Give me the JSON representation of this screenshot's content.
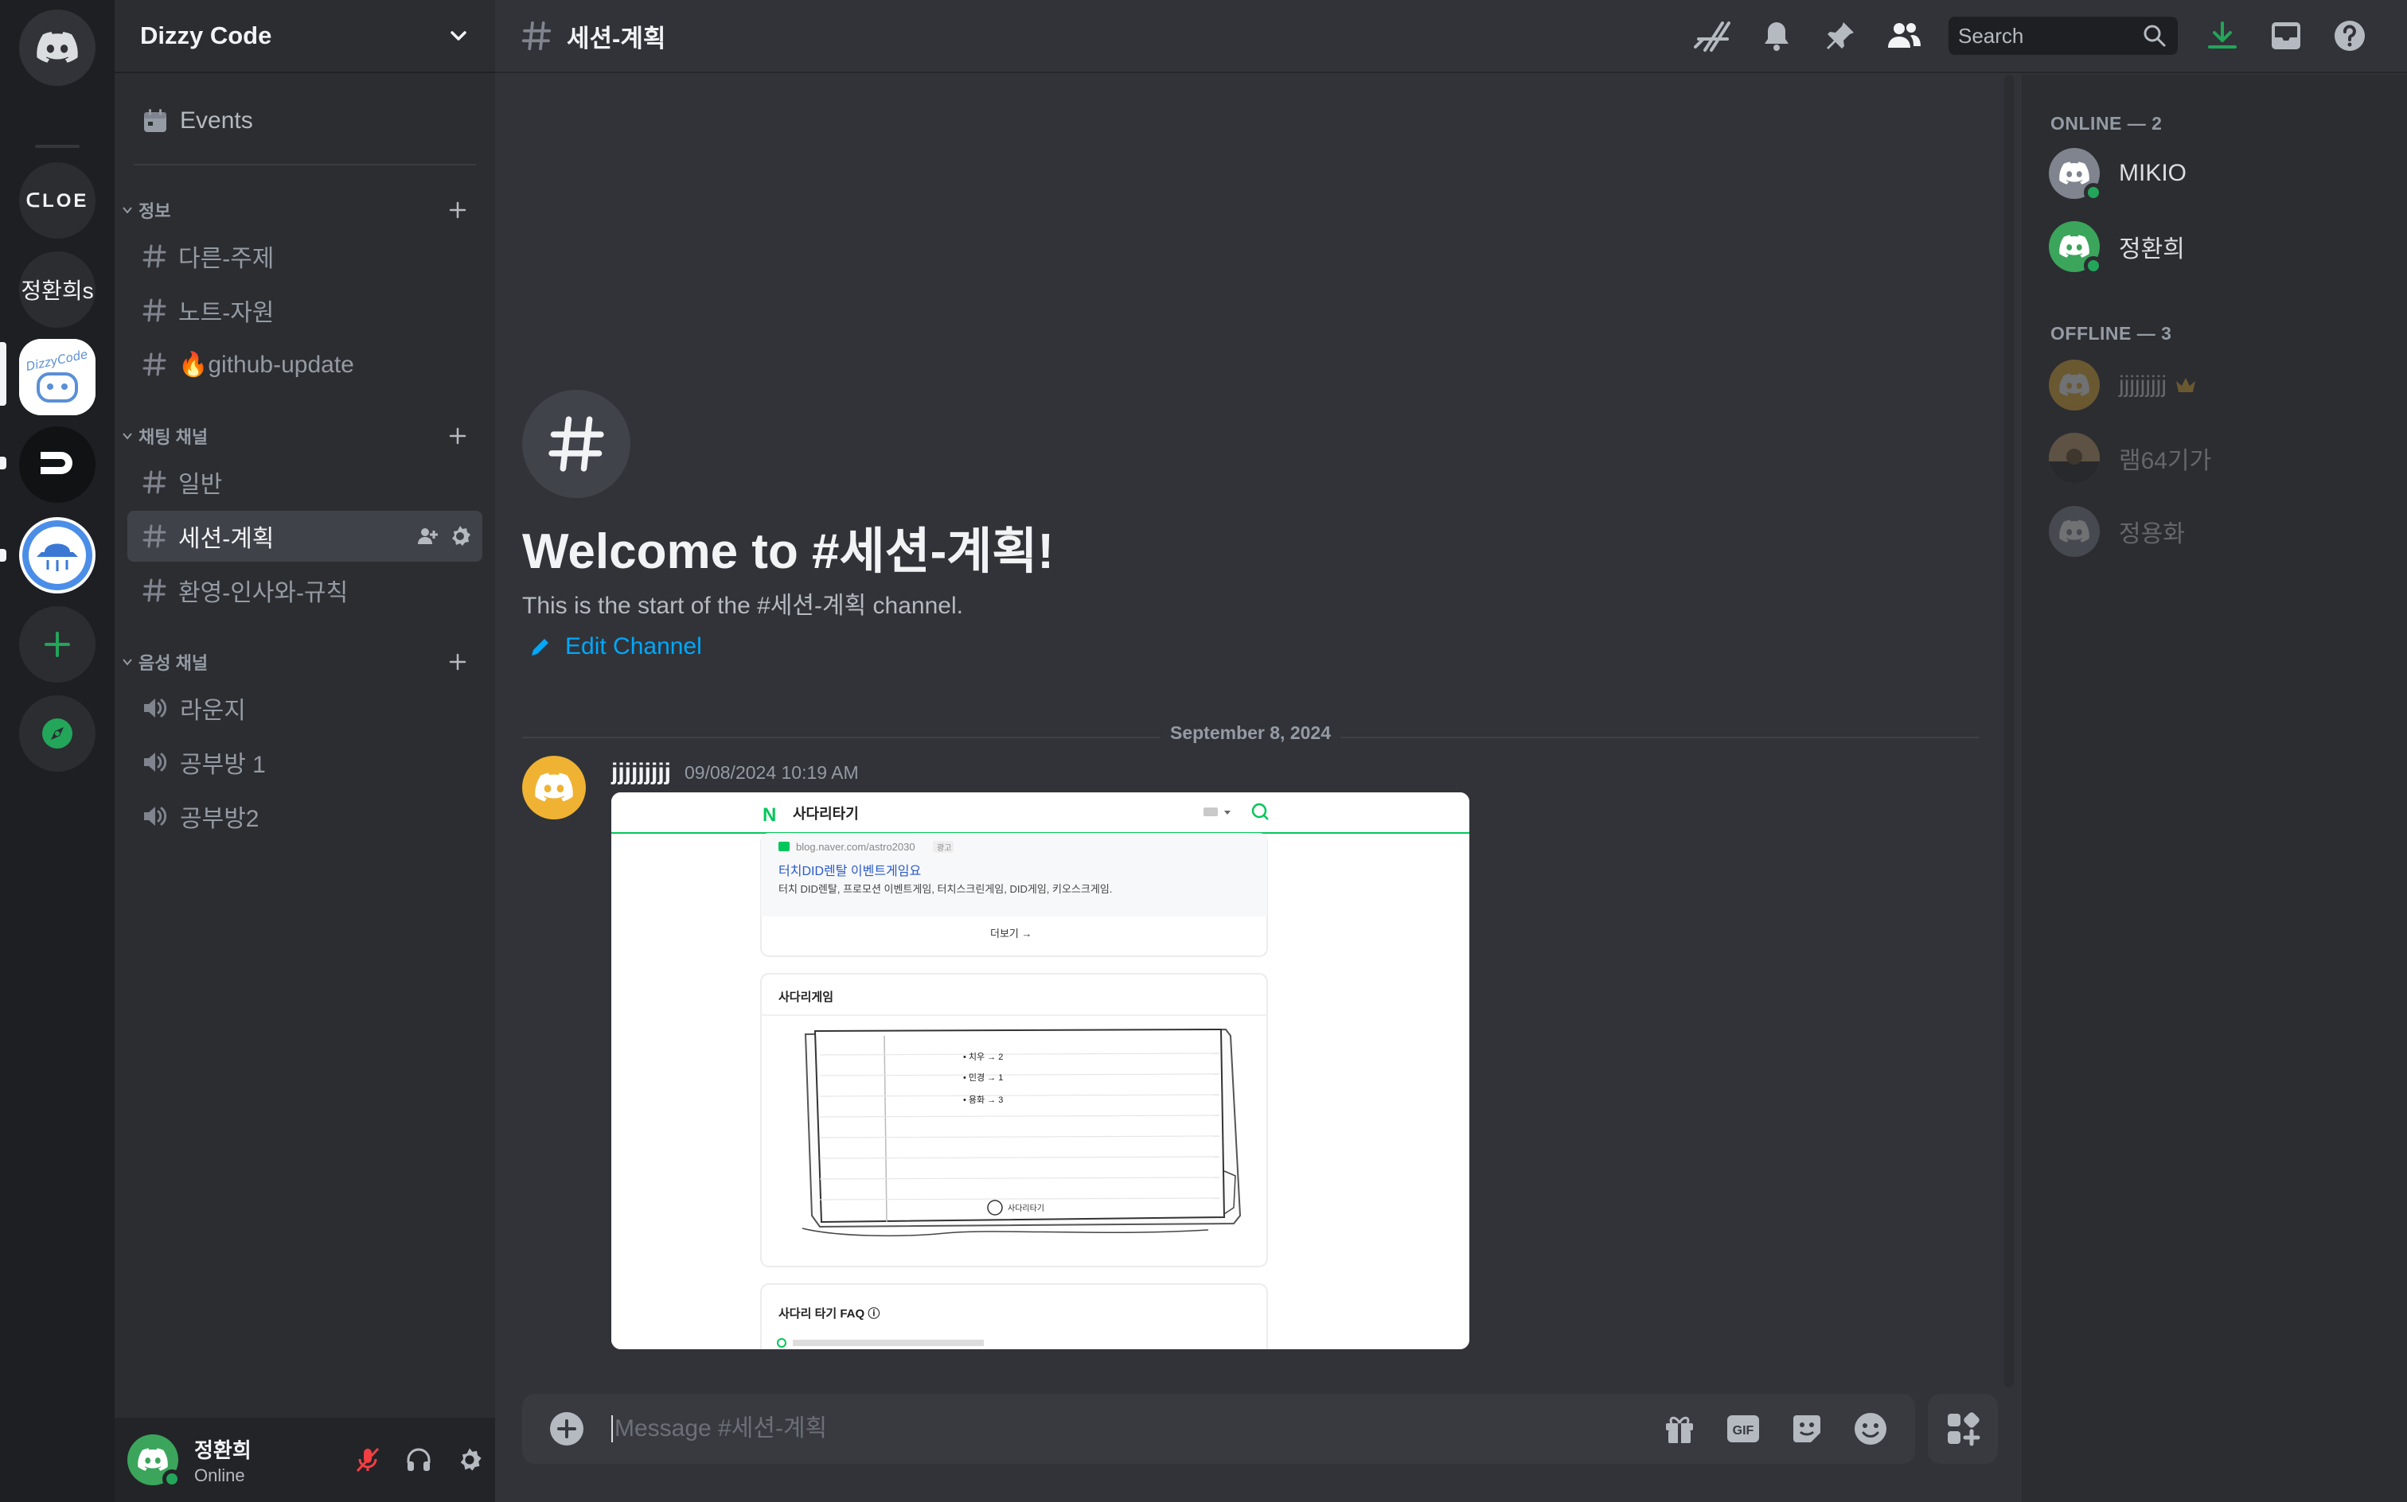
{
  "servers": [
    {
      "name": "home",
      "label": ""
    },
    {
      "name": "ploe",
      "label": "ᑕLOE"
    },
    {
      "name": "jeonghwanhui",
      "label": "정환희s"
    },
    {
      "name": "dizzy-code",
      "label": "DizzyCode"
    },
    {
      "name": "d-server",
      "label": ""
    },
    {
      "name": "hat-server",
      "label": ""
    }
  ],
  "guild": {
    "name": "Dizzy Code"
  },
  "events": {
    "label": "Events"
  },
  "categories": {
    "info": {
      "label": "정보",
      "channels": [
        "다른-주제",
        "노트-자원",
        "🔥github-update"
      ]
    },
    "text": {
      "label": "채팅 채널",
      "channels": [
        "일반",
        "세션-계획",
        "환영-인사와-규칙"
      ]
    },
    "voice": {
      "label": "음성 채널",
      "channels": [
        "라운지",
        "공부방 1",
        "공부방2"
      ]
    }
  },
  "user": {
    "name": "정환희",
    "status": "Online"
  },
  "topbar": {
    "channel": "세션-계획",
    "search_placeholder": "Search"
  },
  "welcome": {
    "title": "Welcome to #세션-계획!",
    "subtitle": "This is the start of the #세션-계획 channel.",
    "edit_label": "Edit Channel"
  },
  "divider": {
    "date": "September 8, 2024"
  },
  "message": {
    "author": "jjjjjjjjj",
    "timestamp": "09/08/2024 10:19 AM",
    "attachment": {
      "app_title": "사다리타기",
      "link_url": "blog.naver.com/astro2030",
      "ad_badge": "광고",
      "link_title": "터치DID렌탈 이벤트게임요",
      "link_desc": "터치 DID렌탈, 프로모션 이벤트게임, 터치스크린게임, DID게임, 키오스크게임.",
      "more": "더보기 →",
      "section_title": "사다리게임",
      "list": [
        "• 치우  → 2",
        "• 민경  → 1",
        "• 용화  → 3"
      ],
      "paper_caption": "사다리타기",
      "faq_title": "사다리 타기 FAQ ⓘ"
    }
  },
  "composer": {
    "placeholder": "Message #세션-계획"
  },
  "members": {
    "online_label": "ONLINE — 2",
    "offline_label": "OFFLINE — 3",
    "online": [
      "MIKIO",
      "정환희"
    ],
    "offline": [
      "jjjjjjjjj",
      "램64기가",
      "정용화"
    ]
  },
  "colors": {
    "accent_green": "#23a55a",
    "link_blue": "#00a8fc",
    "brand": "#5865f2",
    "owner_crown": "#f0b232"
  }
}
